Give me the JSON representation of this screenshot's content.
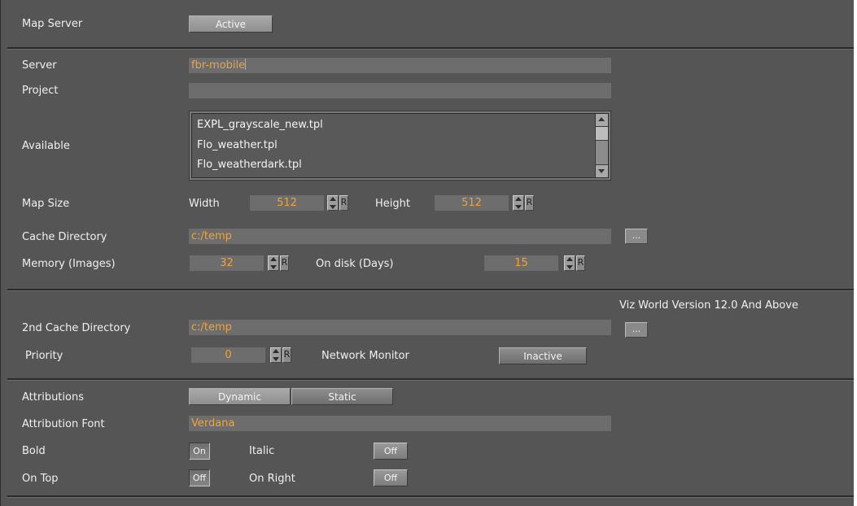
{
  "map_server": {
    "label": "Map Server",
    "button": "Active"
  },
  "server": {
    "label": "Server",
    "value": "fbr-mobile"
  },
  "project": {
    "label": "Project",
    "value": ""
  },
  "available": {
    "label": "Available",
    "items": [
      "EXPL_grayscale_new.tpl",
      "Flo_weather.tpl",
      "Flo_weatherdark.tpl"
    ]
  },
  "map_size": {
    "label": "Map Size",
    "width_label": "Width",
    "width_value": "512",
    "height_label": "Height",
    "height_value": "512",
    "reset": "R"
  },
  "cache_directory": {
    "label": "Cache Directory",
    "value": "c:/temp",
    "browse": "..."
  },
  "memory": {
    "label": "Memory (Images)",
    "value": "32",
    "disk_label": "On disk (Days)",
    "disk_value": "15",
    "reset": "R"
  },
  "section2_note": "Viz World Version 12.0 And Above",
  "cache2": {
    "label": "2nd Cache Directory",
    "value": "c:/temp",
    "browse": "..."
  },
  "priority": {
    "label": "Priority",
    "value": "0",
    "reset": "R",
    "network_label": "Network Monitor",
    "network_button": "Inactive"
  },
  "attributions": {
    "label": "Attributions",
    "dynamic": "Dynamic",
    "static": "Static"
  },
  "attribution_font": {
    "label": "Attribution Font",
    "value": "Verdana"
  },
  "bold": {
    "label": "Bold",
    "value": "On"
  },
  "italic": {
    "label": "Italic",
    "value": "Off"
  },
  "on_top": {
    "label": "On Top",
    "value": "Off"
  },
  "on_right": {
    "label": "On Right",
    "value": "Off"
  }
}
